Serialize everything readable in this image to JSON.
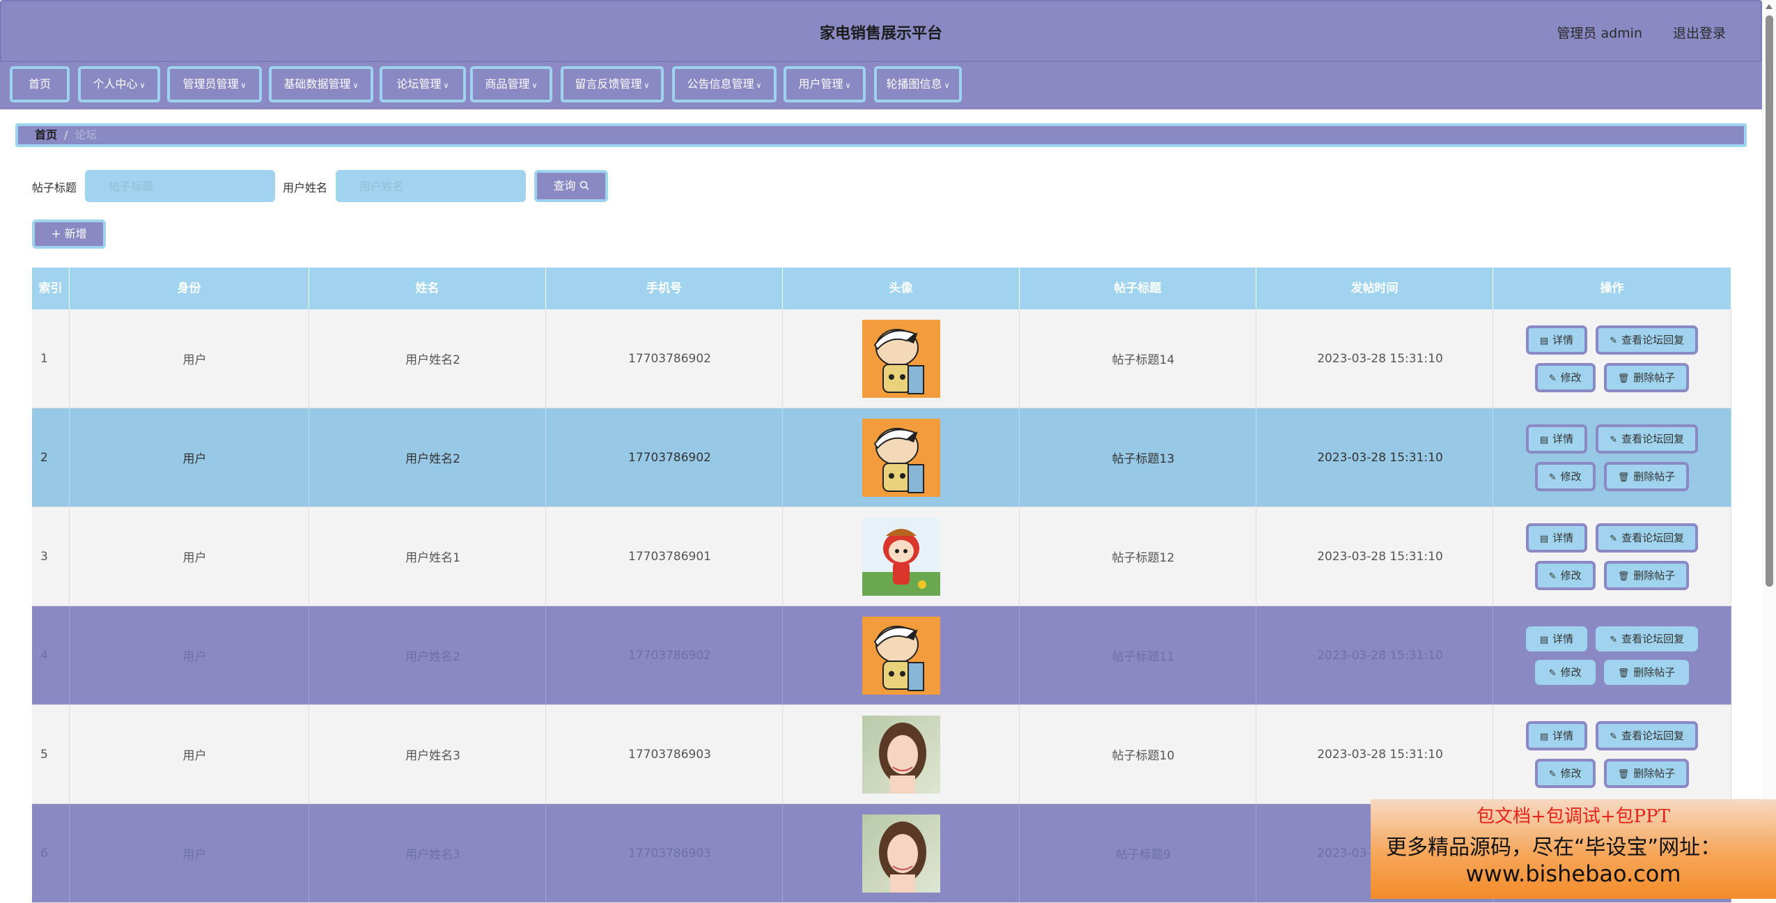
{
  "header": {
    "title": "家电销售展示平台",
    "user": "管理员 admin",
    "logout": "退出登录"
  },
  "nav": [
    {
      "label": "首页",
      "chevron": false
    },
    {
      "label": "个人中心",
      "chevron": true
    },
    {
      "label": "管理员管理",
      "chevron": true
    },
    {
      "label": "基础数据管理",
      "chevron": true
    },
    {
      "label": "论坛管理",
      "chevron": true
    },
    {
      "label": "商品管理",
      "chevron": true
    },
    {
      "label": "留言反馈管理",
      "chevron": true
    },
    {
      "label": "公告信息管理",
      "chevron": true
    },
    {
      "label": "用户管理",
      "chevron": true
    },
    {
      "label": "轮播图信息",
      "chevron": true
    }
  ],
  "breadcrumb": {
    "home": "首页",
    "separator": "/",
    "current": "论坛"
  },
  "search": {
    "title_label": "帖子标题",
    "title_placeholder": "帖子标题",
    "name_label": "用户姓名",
    "name_placeholder": "用户姓名",
    "query_button": "查询",
    "add_button": "新增"
  },
  "table": {
    "headers": [
      "索引",
      "身份",
      "姓名",
      "手机号",
      "头像",
      "帖子标题",
      "发帖时间",
      "操作"
    ],
    "rows": [
      {
        "index": "1",
        "identity": "用户",
        "name": "用户姓名2",
        "phone": "17703786902",
        "avatar": "cartoon-boy",
        "post_title": "帖子标题14",
        "time": "2023-03-28 15:31:10",
        "style": "light"
      },
      {
        "index": "2",
        "identity": "用户",
        "name": "用户姓名2",
        "phone": "17703786902",
        "avatar": "cartoon-boy",
        "post_title": "帖子标题13",
        "time": "2023-03-28 15:31:10",
        "style": "blue"
      },
      {
        "index": "3",
        "identity": "用户",
        "name": "用户姓名1",
        "phone": "17703786901",
        "avatar": "cartoon-girl",
        "post_title": "帖子标题12",
        "time": "2023-03-28 15:31:10",
        "style": "light"
      },
      {
        "index": "4",
        "identity": "用户",
        "name": "用户姓名2",
        "phone": "17703786902",
        "avatar": "cartoon-boy",
        "post_title": "帖子标题11",
        "time": "2023-03-28 15:31:10",
        "style": "purple"
      },
      {
        "index": "5",
        "identity": "用户",
        "name": "用户姓名3",
        "phone": "17703786903",
        "avatar": "photo-woman",
        "post_title": "帖子标题10",
        "time": "2023-03-28 15:31:10",
        "style": "light"
      },
      {
        "index": "6",
        "identity": "用户",
        "name": "用户姓名3",
        "phone": "17703786903",
        "avatar": "photo-woman",
        "post_title": "帖子标题9",
        "time": "2023-03-28 15:31:10",
        "style": "purple"
      }
    ],
    "actions": {
      "detail": "详情",
      "view_replies": "查看论坛回复",
      "edit": "修改",
      "delete": "删除帖子"
    }
  },
  "ad": {
    "line1": "包文档+包调试+包PPT",
    "line2": "更多精品源码，尽在“毕设宝”网址：",
    "line3": "www.bishebao.com"
  },
  "colors": {
    "purple": "#8a89c4",
    "light_blue": "#a0d4ee",
    "row_blue": "#97c9e6",
    "row_light": "#f3f3f4"
  }
}
